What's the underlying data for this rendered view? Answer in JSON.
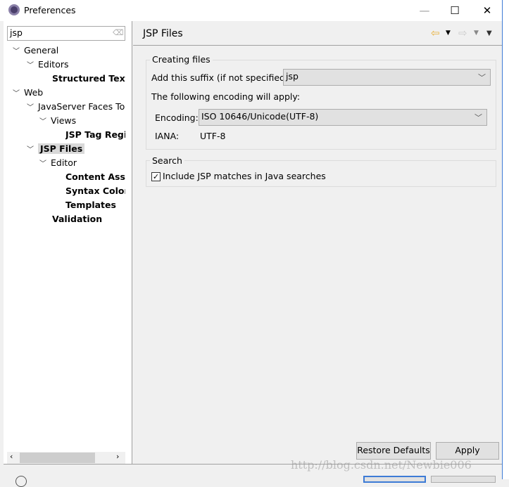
{
  "window": {
    "title": "Preferences",
    "minimize": "—",
    "maximize": "☐",
    "close": "✕"
  },
  "sidebar": {
    "filter_value": "jsp",
    "items": [
      {
        "label": "General",
        "level": 0,
        "expanded": true,
        "bold": false
      },
      {
        "label": "Editors",
        "level": 1,
        "expanded": true,
        "bold": false
      },
      {
        "label": "Structured Text E",
        "level": 2,
        "bold": true
      },
      {
        "label": "Web",
        "level": 0,
        "expanded": true,
        "bold": false
      },
      {
        "label": "JavaServer Faces Too",
        "level": 1,
        "expanded": true,
        "bold": false
      },
      {
        "label": "Views",
        "level": 2,
        "expanded": true,
        "bold": false
      },
      {
        "label": "JSP Tag Regis",
        "level": 3,
        "bold": true
      },
      {
        "label": "JSP Files",
        "level": 1,
        "expanded": true,
        "bold": true,
        "selected": true
      },
      {
        "label": "Editor",
        "level": 2,
        "expanded": true,
        "bold": false
      },
      {
        "label": "Content Assis",
        "level": 3,
        "bold": true
      },
      {
        "label": "Syntax Colorin",
        "level": 3,
        "bold": true
      },
      {
        "label": "Templates",
        "level": 3,
        "bold": true
      },
      {
        "label": "Validation",
        "level": 2,
        "bold": true
      }
    ]
  },
  "page": {
    "title": "JSP Files",
    "creating": {
      "legend": "Creating files",
      "suffix_label": "Add this suffix (if not specified):",
      "suffix_value": "jsp",
      "encoding_note": "The following encoding will apply:",
      "encoding_label": "Encoding:",
      "encoding_value": "ISO 10646/Unicode(UTF-8)",
      "iana_label": "IANA:",
      "iana_value": "UTF-8"
    },
    "search": {
      "legend": "Search",
      "checkbox_label": "Include JSP matches in Java searches",
      "checked": true
    },
    "restore_defaults": "Restore Defaults",
    "apply": "Apply"
  },
  "watermark": "http://blog.csdn.net/Newbie006",
  "colors": {
    "accent": "#3d7bd6",
    "back_arrow": "#e8b13c"
  }
}
